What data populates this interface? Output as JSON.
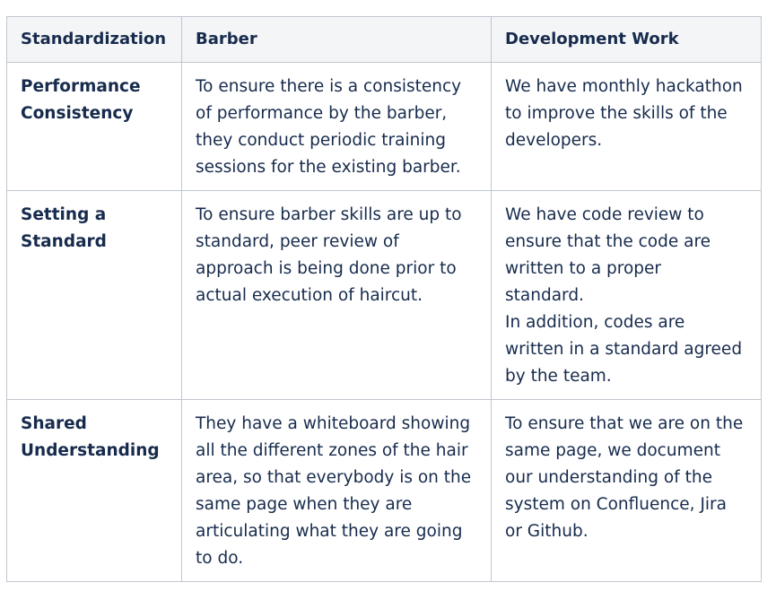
{
  "table": {
    "headers": [
      "Standardization",
      "Barber",
      "Development Work"
    ],
    "rows": [
      {
        "label_lines": [
          "Performance",
          "Consistency"
        ],
        "barber_lines": [
          "To ensure there is a consistency",
          "of performance by the barber,",
          "they conduct periodic training",
          "sessions for the existing barber."
        ],
        "dev_lines": [
          "We have monthly hackathon",
          "to improve the skills of the",
          "developers."
        ]
      },
      {
        "label_lines": [
          "Setting a",
          "Standard"
        ],
        "barber_lines": [
          "To ensure barber skills are up to",
          "standard, peer review of",
          "approach is being done prior to",
          "actual execution of haircut."
        ],
        "dev_lines": [
          "We have code review to",
          "ensure that the code are",
          "written to a proper",
          "standard.",
          "In addition, codes are",
          "written in a standard agreed",
          "by the team."
        ]
      },
      {
        "label_lines": [
          "Shared",
          "Understanding"
        ],
        "barber_lines": [
          "They have a whiteboard showing",
          "all the different zones of the hair",
          "area, so that everybody is on the",
          "same page when they are",
          "articulating what they are going",
          "to do."
        ],
        "dev_lines": [
          "To ensure that we are on the",
          "same page, we document",
          "our understanding of the",
          "system on Confluence, Jira",
          "or Github."
        ]
      }
    ]
  }
}
